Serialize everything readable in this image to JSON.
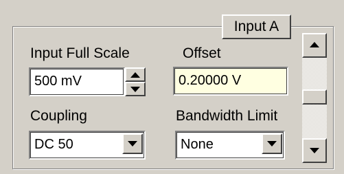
{
  "tab": {
    "label": "Input A"
  },
  "input_full_scale": {
    "label": "Input Full Scale",
    "value": "500 mV"
  },
  "offset": {
    "label": "Offset",
    "value": "0.20000 V"
  },
  "coupling": {
    "label": "Coupling",
    "value": "DC 50"
  },
  "bandwidth_limit": {
    "label": "Bandwidth Limit",
    "value": "None"
  },
  "colors": {
    "panel": "#d4d0c8",
    "offset_field": "#ffffe1"
  },
  "icons": {
    "spin": "spin-arrows-icon",
    "dropdown": "chevron-down-icon",
    "scroll_up": "arrow-up-icon",
    "scroll_down": "arrow-down-icon"
  }
}
